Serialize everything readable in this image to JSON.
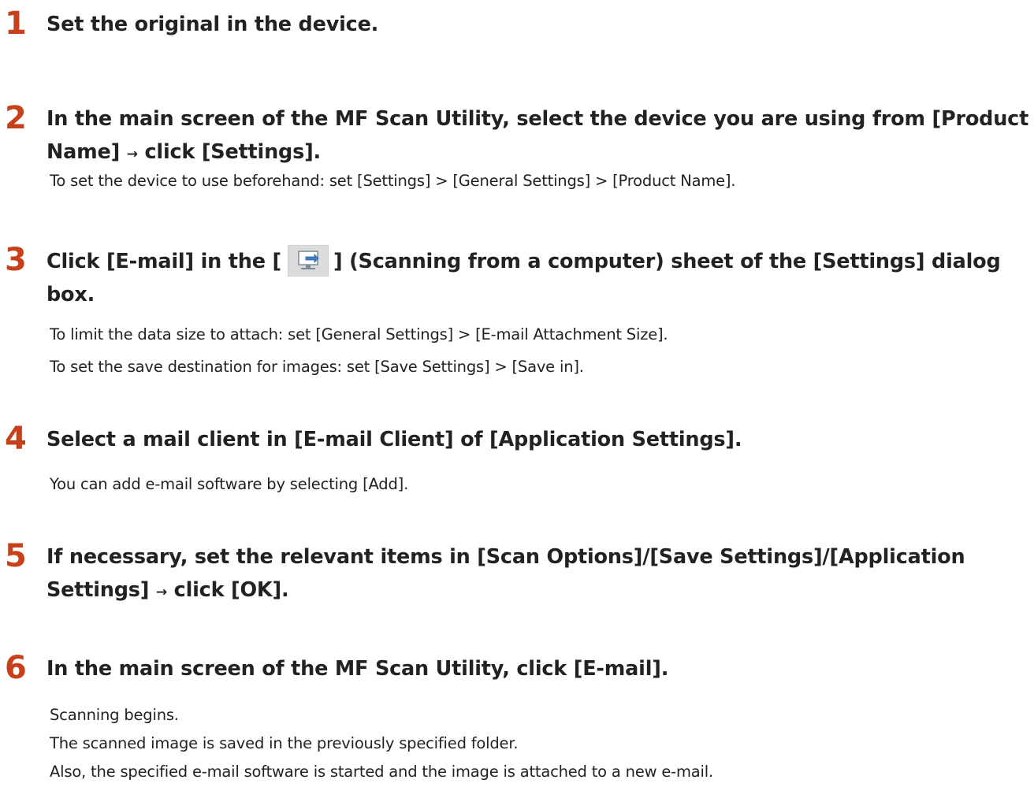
{
  "steps": [
    {
      "number": "1",
      "heading_lines": [
        "Set the original in the device."
      ],
      "descriptions": []
    },
    {
      "number": "2",
      "heading_line1": "In the main screen of the MF Scan Utility, select the device you are using from [Product",
      "heading_line2_a": "Name]",
      "heading_line2_arrow": "→",
      "heading_line2_b": "click [Settings].",
      "descriptions": [
        "To set the device to use beforehand: set [Settings] > [General Settings] > [Product Name]."
      ]
    },
    {
      "number": "3",
      "heading_line1_a": "Click [E-mail] in the [",
      "heading_line1_icon": "computer-scan-icon",
      "heading_line1_b": "] (Scanning from a computer) sheet of the [Settings] dialog",
      "heading_line2": "box.",
      "descriptions": [
        "To limit the data size to attach: set [General Settings] > [E-mail Attachment Size].",
        "To set the save destination for images: set [Save Settings] > [Save in]."
      ]
    },
    {
      "number": "4",
      "heading_line1": "Select a mail client in [E-mail Client] of [Application Settings].",
      "descriptions": [
        "You can add e-mail software by selecting [Add]."
      ]
    },
    {
      "number": "5",
      "heading_line1": "If necessary, set the relevant items in [Scan Options]/[Save Settings]/[Application",
      "heading_line2_a": "Settings]",
      "heading_line2_arrow": "→",
      "heading_line2_b": "click [OK].",
      "descriptions": []
    },
    {
      "number": "6",
      "heading_line1": "In the main screen of the MF Scan Utility, click [E-mail].",
      "descriptions": [
        "Scanning begins.",
        "The scanned image is saved in the previously specified folder.",
        "Also, the specified e-mail software is started and the image is attached to a new e-mail."
      ]
    }
  ],
  "colors": {
    "step_number": "#c8401a",
    "text": "#222222"
  }
}
